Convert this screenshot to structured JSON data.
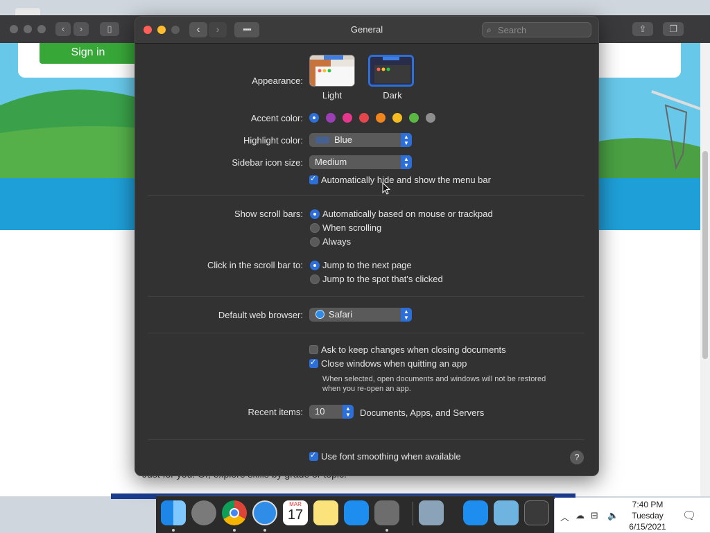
{
  "background": {
    "signin_label": "Sign in",
    "bottom_text": "Just for you! Or, explore skills by grade or topic."
  },
  "window": {
    "title": "General",
    "search_placeholder": "Search"
  },
  "appearance": {
    "label": "Appearance:",
    "options": [
      {
        "name": "Light",
        "selected": false
      },
      {
        "name": "Dark",
        "selected": true
      }
    ]
  },
  "accent": {
    "label": "Accent color:",
    "colors": [
      "#2d6fd8",
      "#9b3fb5",
      "#e5388d",
      "#e5454d",
      "#f0851d",
      "#f5bb23",
      "#5cb845",
      "#8e8e8e"
    ],
    "selected_index": 0
  },
  "highlight": {
    "label": "Highlight color:",
    "value": "Blue",
    "swatch": "#46618f"
  },
  "sidebar_icon": {
    "label": "Sidebar icon size:",
    "value": "Medium"
  },
  "auto_hide_menu": {
    "label": "Automatically hide and show the menu bar",
    "checked": true
  },
  "scroll_bars": {
    "label": "Show scroll bars:",
    "options": [
      "Automatically based on mouse or trackpad",
      "When scrolling",
      "Always"
    ],
    "selected_index": 0
  },
  "click_scroll": {
    "label": "Click in the scroll bar to:",
    "options": [
      "Jump to the next page",
      "Jump to the spot that's clicked"
    ],
    "selected_index": 0
  },
  "browser": {
    "label": "Default web browser:",
    "value": "Safari"
  },
  "ask_keep_changes": {
    "label": "Ask to keep changes when closing documents",
    "checked": false
  },
  "close_windows": {
    "label": "Close windows when quitting an app",
    "checked": true,
    "note_line1": "When selected, open documents and windows will not be restored",
    "note_line2": "when you re-open an app."
  },
  "recent_items": {
    "label": "Recent items:",
    "value": "10",
    "suffix": "Documents, Apps, and Servers"
  },
  "font_smoothing": {
    "label": "Use font smoothing when available",
    "checked": true
  },
  "help_label": "?",
  "dock": {
    "calendar_month": "MAR",
    "calendar_day": "17",
    "apps": [
      "Finder",
      "Launchpad",
      "Chrome",
      "Safari",
      "Calendar",
      "Notes",
      "App Store",
      "System Preferences",
      "Preview",
      "App Store",
      "Downloads",
      "Trash"
    ]
  },
  "taskbar": {
    "time": "7:40 PM",
    "day": "Tuesday",
    "date": "6/15/2021"
  }
}
